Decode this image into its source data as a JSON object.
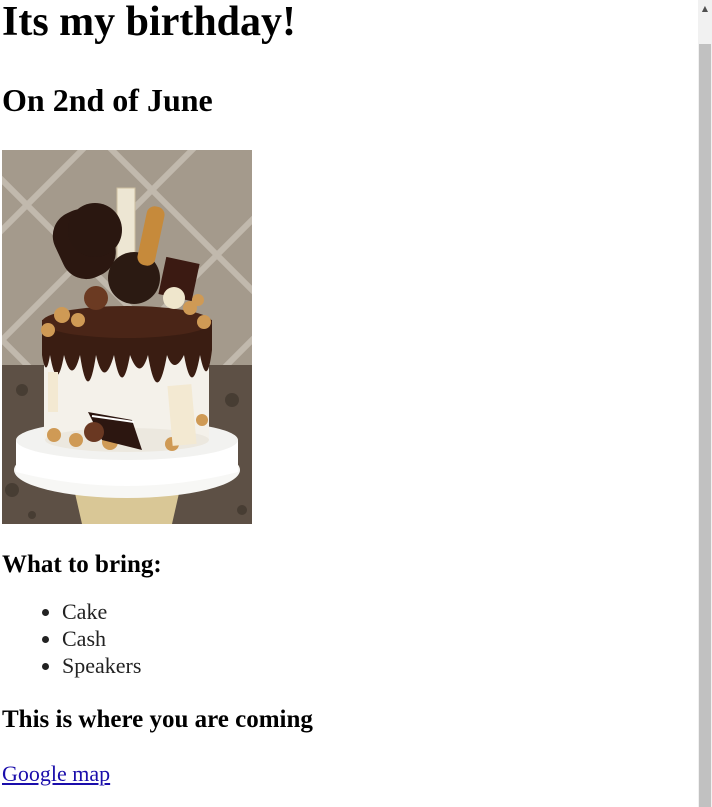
{
  "page": {
    "title": "Its my birthday!",
    "date_heading": "On 2nd of June",
    "bring_heading": "What to bring:",
    "items": [
      "Cake",
      "Cash",
      "Speakers"
    ],
    "where_heading": "This is where you are coming",
    "map_link": "Google map"
  },
  "image": {
    "name": "cake-photo",
    "icon": "cake-image"
  },
  "colors": {
    "link": "#1a0dab",
    "text": "#000000",
    "scrollbar_track": "#f1f1f1",
    "scrollbar_thumb": "#c1c1c1"
  },
  "scrollbar": {
    "up_icon": "scroll-up-arrow-icon"
  }
}
